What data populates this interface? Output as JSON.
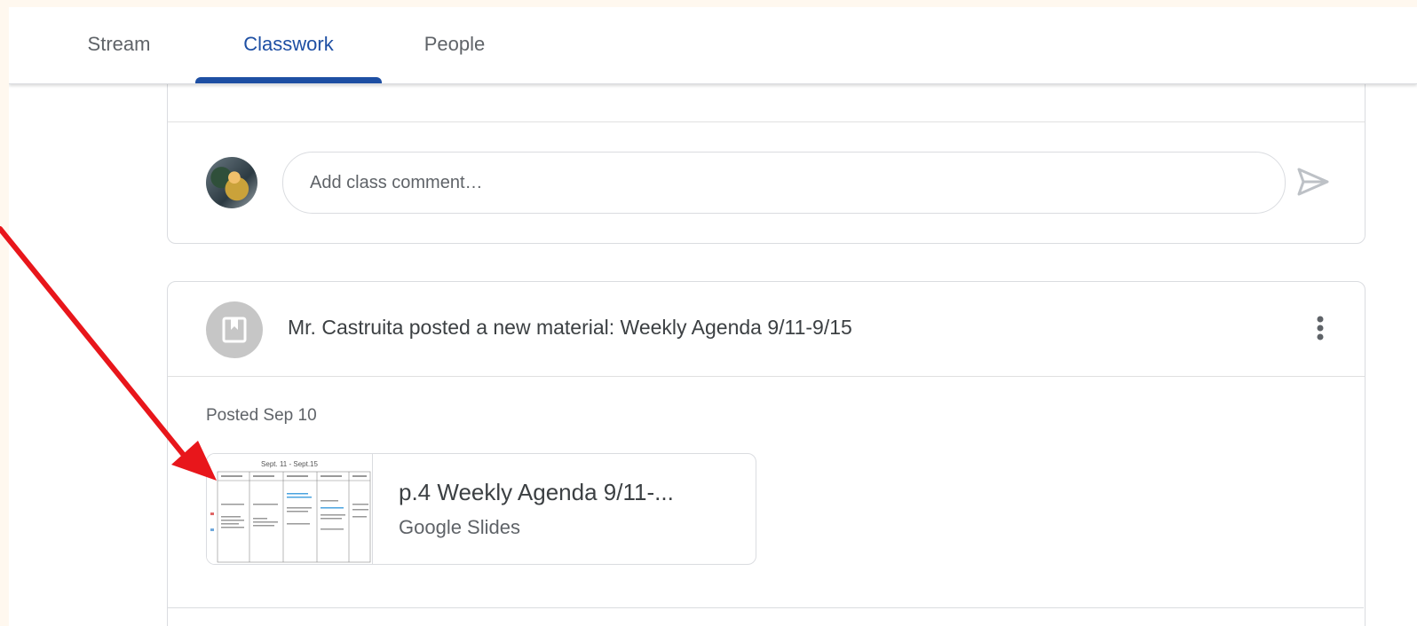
{
  "tabs": [
    {
      "label": "Stream"
    },
    {
      "label": "Classwork"
    },
    {
      "label": "People"
    }
  ],
  "comment": {
    "placeholder": "Add class comment…"
  },
  "post": {
    "title": "Mr. Castruita posted a new material: Weekly Agenda 9/11-9/15",
    "posted": "Posted Sep 10",
    "attachment": {
      "title": "p.4 Weekly Agenda 9/11-...",
      "type": "Google Slides",
      "thumbnail_heading": "Sept. 11 - Sept.15"
    }
  },
  "colors": {
    "accent": "#1e4fa3",
    "arrow": "#e8161b",
    "icon_gray": "#c6c6c6"
  },
  "icons": {
    "send": "send-icon",
    "material": "bookmark-icon",
    "more": "more-vert-icon"
  }
}
